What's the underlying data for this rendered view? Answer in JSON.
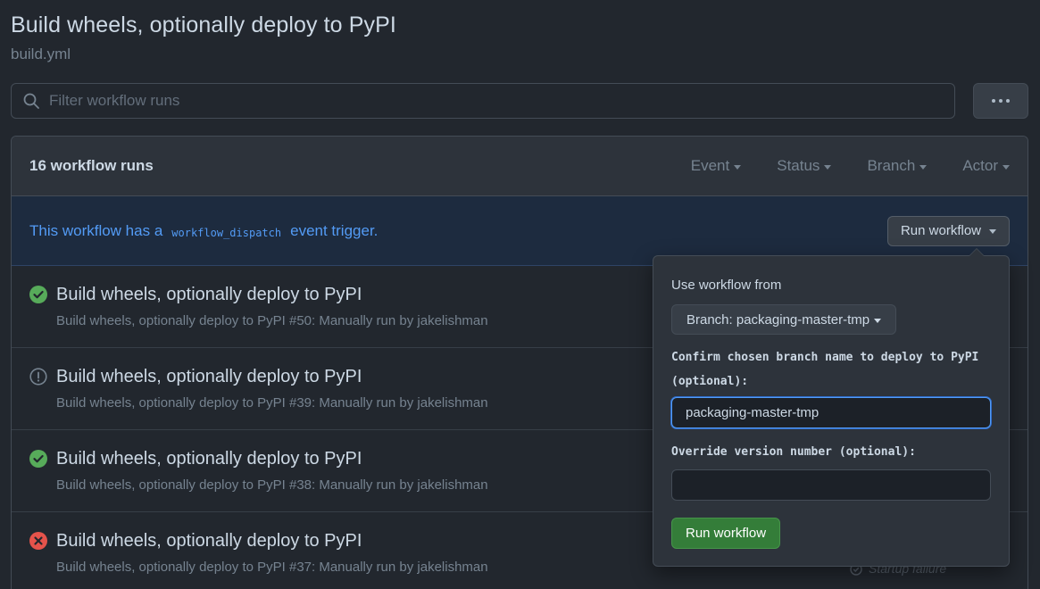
{
  "header": {
    "title": "Build wheels, optionally deploy to PyPI",
    "subtitle": "build.yml"
  },
  "filter": {
    "placeholder": "Filter workflow runs"
  },
  "runs_box": {
    "count_label": "16 workflow runs",
    "filters": [
      "Event",
      "Status",
      "Branch",
      "Actor"
    ]
  },
  "banner": {
    "text_before": "This workflow has a",
    "code": "workflow_dispatch",
    "text_after": "event trigger.",
    "button_label": "Run workflow"
  },
  "runs": [
    {
      "status": "success",
      "title": "Build wheels, optionally deploy to PyPI",
      "meta": "Build wheels, optionally deploy to PyPI #50: Manually run by jakelishman"
    },
    {
      "status": "warning",
      "title": "Build wheels, optionally deploy to PyPI",
      "meta": "Build wheels, optionally deploy to PyPI #39: Manually run by jakelishman"
    },
    {
      "status": "success",
      "title": "Build wheels, optionally deploy to PyPI",
      "meta": "Build wheels, optionally deploy to PyPI #38: Manually run by jakelishman"
    },
    {
      "status": "failure",
      "title": "Build wheels, optionally deploy to PyPI",
      "meta": "Build wheels, optionally deploy to PyPI #37: Manually run by jakelishman",
      "status_text": "Startup failure"
    }
  ],
  "popover": {
    "use_from_label": "Use workflow from",
    "branch_select": "Branch: packaging-master-tmp",
    "branch_field_label": "Confirm chosen branch name to deploy to PyPI (optional):",
    "branch_field_value": "packaging-master-tmp",
    "version_field_label": "Override version number (optional):",
    "version_field_value": "",
    "submit_label": "Run workflow"
  },
  "colors": {
    "background": "#22272e",
    "success": "#57ab5a",
    "failure": "#e5534b",
    "accent": "#539bf5",
    "primary_button": "#347d39"
  }
}
